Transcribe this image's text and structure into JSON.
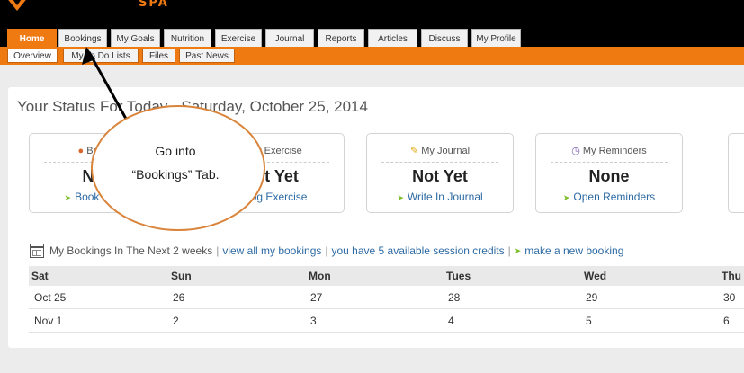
{
  "brand": {
    "logo_text": "SPA"
  },
  "nav": {
    "tabs": [
      {
        "label": "Home",
        "active": true
      },
      {
        "label": "Bookings",
        "active": false
      },
      {
        "label": "My Goals",
        "active": false
      },
      {
        "label": "Nutrition",
        "active": false
      },
      {
        "label": "Exercise",
        "active": false
      },
      {
        "label": "Journal",
        "active": false
      },
      {
        "label": "Reports",
        "active": false
      },
      {
        "label": "Articles",
        "active": false
      },
      {
        "label": "Discuss",
        "active": false
      },
      {
        "label": "My Profile",
        "active": false
      }
    ],
    "subtabs": [
      {
        "label": "Overview",
        "active": true
      },
      {
        "label": "My To Do Lists",
        "active": false
      },
      {
        "label": "Files",
        "active": false
      },
      {
        "label": "Past News",
        "active": false
      }
    ]
  },
  "status": {
    "title": "Your Status For Today - Saturday, October 25, 2014",
    "cards": [
      {
        "label": "Bookings",
        "value": "None",
        "link": "Book Session",
        "icon": "apple-icon"
      },
      {
        "label": "My Exercise",
        "value": "Not Yet",
        "link": "Log Exercise",
        "icon": "exercise-icon"
      },
      {
        "label": "My Journal",
        "value": "Not Yet",
        "link": "Write In Journal",
        "icon": "pencil-icon"
      },
      {
        "label": "My Reminders",
        "value": "None",
        "link": "Open Reminders",
        "icon": "clock-icon"
      }
    ]
  },
  "bookings": {
    "intro": "My Bookings In The Next 2 weeks",
    "view_all": "view all my bookings",
    "credits": "you have 5 available session credits",
    "new_booking": "make a new booking"
  },
  "calendar": {
    "days": [
      "Sat",
      "Sun",
      "Mon",
      "Tues",
      "Wed",
      "Thu"
    ],
    "weeks": [
      [
        "Oct 25",
        "26",
        "27",
        "28",
        "29",
        "30"
      ],
      [
        "Nov 1",
        "2",
        "3",
        "4",
        "5",
        "6"
      ]
    ]
  },
  "annotation": {
    "line1": "Go into",
    "line2": "“Bookings” Tab."
  },
  "colors": {
    "accent": "#f07a12",
    "link": "#2d6aa3",
    "arrow_green": "#7cbd2a",
    "callout_border": "#d9843a"
  }
}
